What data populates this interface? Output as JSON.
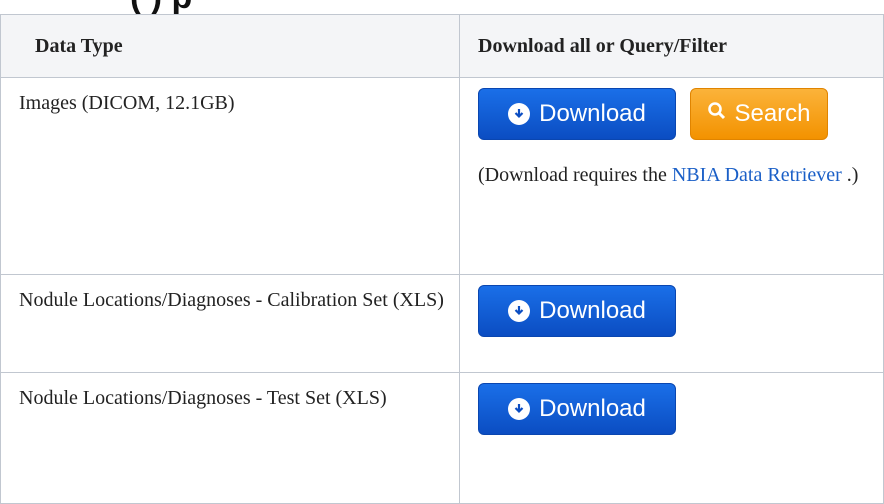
{
  "heading_fragment": "(       ) p",
  "table": {
    "headers": [
      "Data Type",
      "Download all or Query/Filter"
    ],
    "rows": [
      {
        "data_type": "Images (DICOM, 12.1GB)",
        "download_label": "Download",
        "search_label": "Search",
        "note_prefix": "(Download requires the ",
        "note_link": "NBIA Data Retriever",
        "note_suffix": " .)"
      },
      {
        "data_type": "Nodule Locations/Diagnoses - Calibration Set (XLS)",
        "download_label": "Download"
      },
      {
        "data_type": "Nodule Locations/Diagnoses - Test Set (XLS)",
        "download_label": "Download"
      }
    ]
  },
  "colors": {
    "download_button": "#0b4dc2",
    "search_button": "#f39200",
    "link": "#1a5fc7",
    "border": "#c1c7d0"
  },
  "icons": {
    "download": "download-circle-icon",
    "search": "search-icon"
  }
}
